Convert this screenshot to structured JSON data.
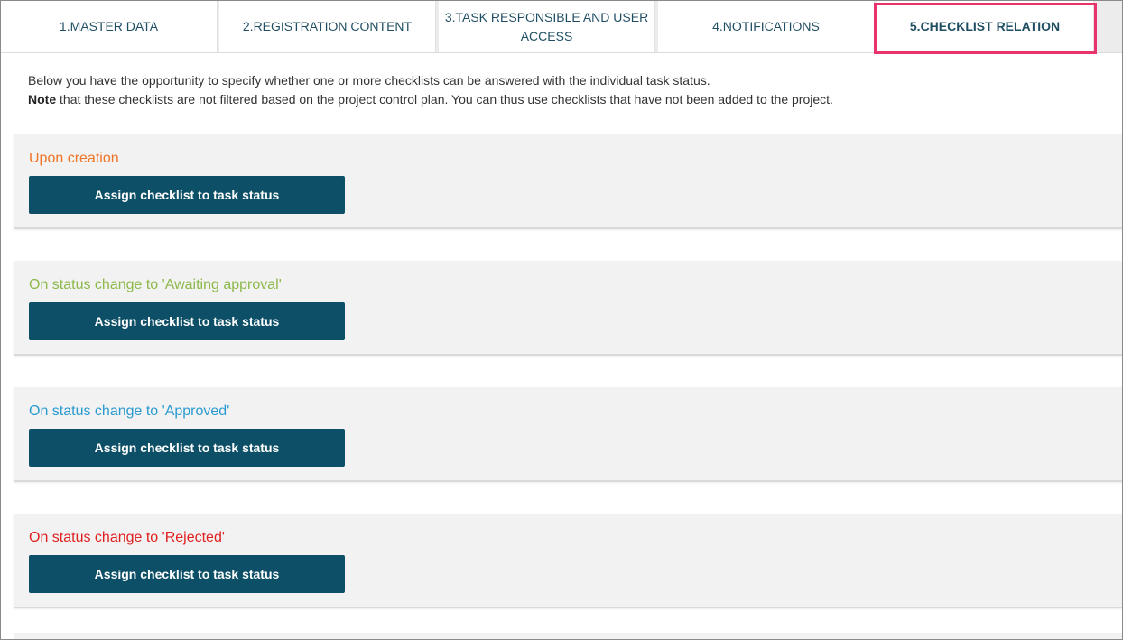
{
  "tabs": [
    {
      "label_lines": [
        "1.MASTER DATA"
      ]
    },
    {
      "label_lines": [
        "2.REGISTRATION CONTENT"
      ]
    },
    {
      "label_lines": [
        "3.TASK RESPONSIBLE AND USER",
        "ACCESS"
      ]
    },
    {
      "label_lines": [
        "4.NOTIFICATIONS"
      ]
    },
    {
      "label_lines": [
        "5.CHECKLIST RELATION"
      ],
      "active": true
    }
  ],
  "intro": {
    "line1": "Below you have the opportunity to specify whether one or more checklists can be answered with the individual task status.",
    "note_label": "Note",
    "line2_rest": " that these checklists are not filtered based on the project control plan. You can thus use checklists that have not been added to the project."
  },
  "sections": [
    {
      "title": "Upon creation",
      "button_label": "Assign checklist to task status",
      "color": "#f07427"
    },
    {
      "title": "On status change to 'Awaiting approval'",
      "button_label": "Assign checklist to task status",
      "color": "#8db84a"
    },
    {
      "title": "On status change to 'Approved'",
      "button_label": "Assign checklist to task status",
      "color": "#2a9bd0"
    },
    {
      "title": "On status change to 'Rejected'",
      "button_label": "Assign checklist to task status",
      "color": "#e01f1f"
    }
  ],
  "colors": {
    "button_bg": "#0c4f66",
    "tab_text": "#1f4e63",
    "highlight": "#e8336b"
  }
}
